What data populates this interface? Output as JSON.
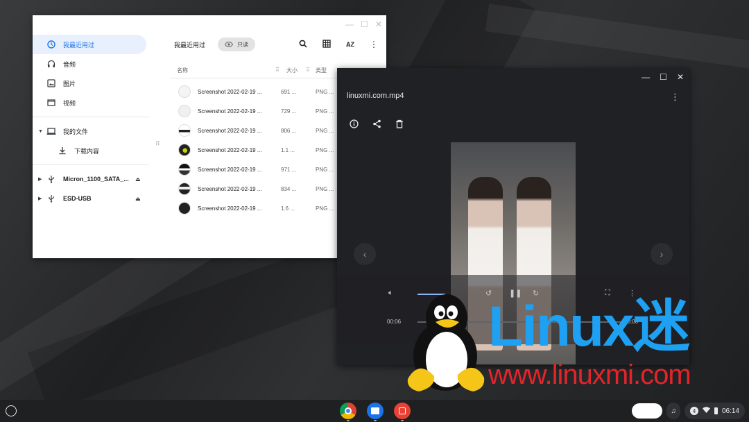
{
  "files": {
    "sidebar": [
      {
        "label": "我最近用过",
        "icon": "clock-icon",
        "active": true
      },
      {
        "label": "音频",
        "icon": "headphones-icon"
      },
      {
        "label": "图片",
        "icon": "image-icon"
      },
      {
        "label": "视频",
        "icon": "video-icon"
      }
    ],
    "my_files": "我的文件",
    "downloads": "下载内容",
    "drives": [
      {
        "label": "Micron_1100_SATA_..."
      },
      {
        "label": "ESD-USB"
      }
    ],
    "toolbar": {
      "title": "我最近用过",
      "readonly": "只读"
    },
    "columns": {
      "name": "名称",
      "size": "大小",
      "type": "类型"
    },
    "rows": [
      {
        "name": "Screenshot 2022-02-19 ...",
        "size": "691 ...",
        "type": "PNG ..."
      },
      {
        "name": "Screenshot 2022-02-19 ...",
        "size": "729 ...",
        "type": "PNG ..."
      },
      {
        "name": "Screenshot 2022-02-19 ...",
        "size": "806 ...",
        "type": "PNG ..."
      },
      {
        "name": "Screenshot 2022-02-19 ...",
        "size": "1.1 ...",
        "type": "PNG ..."
      },
      {
        "name": "Screenshot 2022-02-19 ...",
        "size": "971 ...",
        "type": "PNG ..."
      },
      {
        "name": "Screenshot 2022-02-19 ...",
        "size": "834 ...",
        "type": "PNG ..."
      },
      {
        "name": "Screenshot 2022-02-19 ...",
        "size": "1.6 ...",
        "type": "PNG ..."
      }
    ]
  },
  "media": {
    "title": "linuxmi.com.mp4",
    "time_current": "00:06",
    "time_total": "00:06"
  },
  "watermark": {
    "brand": "Linux迷",
    "url": "www.linuxmi.com"
  },
  "shelf": {
    "notification_count": "4",
    "clock": "06:14"
  },
  "colors": {
    "accent": "#1a73e8",
    "brand_blue": "#1ea1f2",
    "brand_red": "#e3242b"
  }
}
